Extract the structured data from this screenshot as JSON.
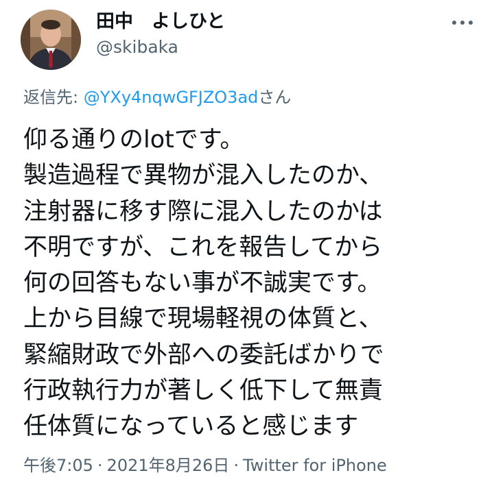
{
  "author": {
    "display_name": "田中　よしひと",
    "handle": "@skibaka"
  },
  "reply": {
    "prefix": "返信先: ",
    "mention": "@YXy4nqwGFJZO3ad",
    "suffix": "さん"
  },
  "tweet": {
    "lines": [
      "仰る通りのlotです。",
      "製造過程で異物が混入したのか、",
      "注射器に移す際に混入したのかは",
      "不明ですが、これを報告してから",
      "何の回答もない事が不誠実です。",
      "上から目線で現場軽視の体質と、",
      "緊縮財政で外部への委託ばかりで",
      "行政執行力が著しく低下して無責",
      "任体質になっていると感じます"
    ]
  },
  "meta": {
    "time": "午後7:05",
    "date": "2021年8月26日",
    "source": "Twitter for iPhone",
    "separator": "·"
  },
  "icons": {
    "more": "more-horizontal-icon",
    "avatar": "profile-photo"
  },
  "colors": {
    "text": "#0f1419",
    "secondary": "#536471",
    "link": "#1d9bf0"
  }
}
